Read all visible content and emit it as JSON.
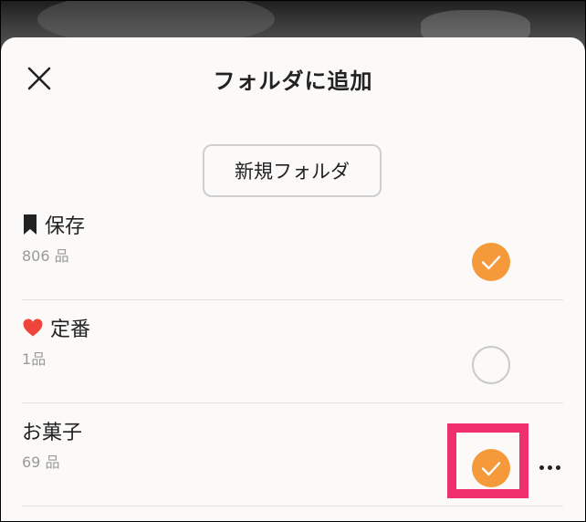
{
  "sheet": {
    "title": "フォルダに追加",
    "close_icon": "close-icon",
    "new_folder_label": "新規フォルダ"
  },
  "folders": [
    {
      "name": "保存",
      "icon": "bookmark-icon",
      "count": "806",
      "unit": "品",
      "checked": true
    },
    {
      "name": "定番",
      "icon": "heart-icon",
      "count": "1",
      "unit": "品",
      "checked": false
    },
    {
      "name": "お菓子",
      "icon": "",
      "count": "69",
      "unit": "品",
      "checked": true,
      "highlighted": true
    }
  ],
  "colors": {
    "accent_orange": "#f59a3a",
    "heart_red": "#f0453a",
    "highlight_pink": "#f0306e",
    "text_primary": "#222222",
    "text_secondary": "#9a9a9a"
  }
}
